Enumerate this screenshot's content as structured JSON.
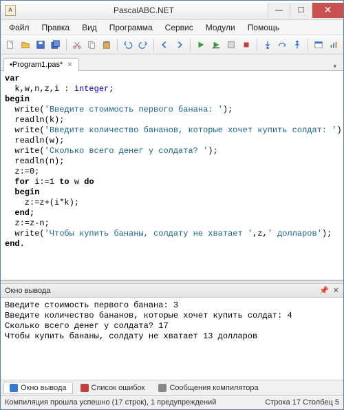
{
  "window": {
    "title": "PascalABC.NET"
  },
  "menu": [
    "Файл",
    "Правка",
    "Вид",
    "Программа",
    "Сервис",
    "Модули",
    "Помощь"
  ],
  "tabs": [
    {
      "label": "•Program1.pas*"
    }
  ],
  "code": {
    "lines": [
      {
        "t": "kw",
        "s": "var"
      },
      {
        "t": "plain",
        "s": "  k,w,n,z,i : ",
        "tail": {
          "t": "ty",
          "s": "integer"
        },
        "end": ";"
      },
      {
        "t": "kw",
        "s": "begin"
      },
      {
        "t": "call",
        "indent": "  ",
        "fn": "write",
        "str": "'Введите стоимость первого банана: '",
        "end": ");"
      },
      {
        "t": "call",
        "indent": "  ",
        "fn": "readln",
        "args": "k",
        "end": ");"
      },
      {
        "t": "call",
        "indent": "  ",
        "fn": "write",
        "str": "'Введите количество бананов, которые хочет купить солдат: '",
        "end": ");"
      },
      {
        "t": "call",
        "indent": "  ",
        "fn": "readln",
        "args": "w",
        "end": ");"
      },
      {
        "t": "call",
        "indent": "  ",
        "fn": "write",
        "str": "'Сколько всего денег у солдата? '",
        "end": ");"
      },
      {
        "t": "call",
        "indent": "  ",
        "fn": "readln",
        "args": "n",
        "end": ");"
      },
      {
        "t": "plain",
        "s": "  z:=0;"
      },
      {
        "t": "for",
        "s": "  for i:=1 to w do"
      },
      {
        "t": "kw",
        "s": "  begin"
      },
      {
        "t": "plain",
        "s": "    z:=z+(i*k);"
      },
      {
        "t": "kw",
        "s": "  end;",
        "after": ""
      },
      {
        "t": "plain",
        "s": "  z:=z-n;"
      },
      {
        "t": "call",
        "indent": "  ",
        "fn": "write",
        "str": "'Чтобы купить бананы, солдату не хватает '",
        "extra": ",z,",
        "str2": "' долларов'",
        "end": ");"
      },
      {
        "t": "kw",
        "s": "end."
      }
    ]
  },
  "output_panel": {
    "title": "Окно вывода",
    "lines": [
      "Введите стоимость первого банана: 3",
      "Введите количество бананов, которые хочет купить солдат: 4",
      "Сколько всего денег у солдата? 17",
      "Чтобы купить бананы, солдату не хватает 13 долларов"
    ]
  },
  "bottom_tabs": [
    {
      "label": "Окно вывода",
      "active": true
    },
    {
      "label": "Список ошибок",
      "active": false
    },
    {
      "label": "Сообщения компилятора",
      "active": false
    }
  ],
  "status": {
    "left": "Компиляция прошла успешно (17 строк), 1 предупреждений",
    "right": "Строка  17  Столбец  5"
  }
}
